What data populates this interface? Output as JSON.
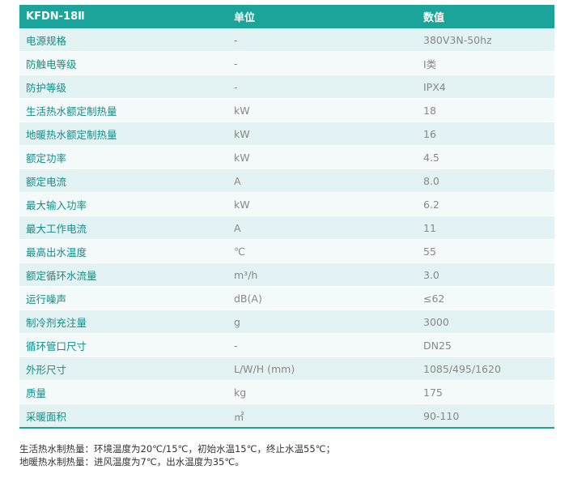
{
  "table": {
    "headers": [
      "KFDN-18Ⅱ",
      "单位",
      "数值"
    ],
    "rows": [
      [
        "电源规格",
        "-",
        "380V3N-50hz"
      ],
      [
        "防触电等级",
        "-",
        "I类"
      ],
      [
        "防护等级",
        "-",
        "IPX4"
      ],
      [
        "生活热水额定制热量",
        "kW",
        "18"
      ],
      [
        "地暖热水额定制热量",
        "kW",
        "16"
      ],
      [
        "额定功率",
        "kW",
        "4.5"
      ],
      [
        "额定电流",
        "A",
        "8.0"
      ],
      [
        "最大输入功率",
        "kW",
        "6.2"
      ],
      [
        "最大工作电流",
        "A",
        "11"
      ],
      [
        "最高出水温度",
        "℃",
        "55"
      ],
      [
        "额定循环水流量",
        "m³/h",
        "3.0"
      ],
      [
        "运行噪声",
        "dB(A)",
        "≤62"
      ],
      [
        "制冷剂充注量",
        "g",
        "3000"
      ],
      [
        "循环管口尺寸",
        "-",
        "DN25"
      ],
      [
        "外形尺寸",
        "L/W/H (mm)",
        "1085/495/1620"
      ],
      [
        "质量",
        "kg",
        "175"
      ],
      [
        "采暖面积",
        "㎡",
        "90-110"
      ]
    ]
  },
  "notes": [
    "生活热水制热量：环境温度为20℃/15℃，初始水温15℃，终止水温55℃；",
    "地暖热水制热量：进风温度为7℃，出水温度为35℃。"
  ],
  "colors": {
    "header_bg": "#1ba59a",
    "row_odd": "#e3f2f2",
    "row_even": "#f4f9f9",
    "name_text": "#0e8f89",
    "value_text": "#888888"
  }
}
